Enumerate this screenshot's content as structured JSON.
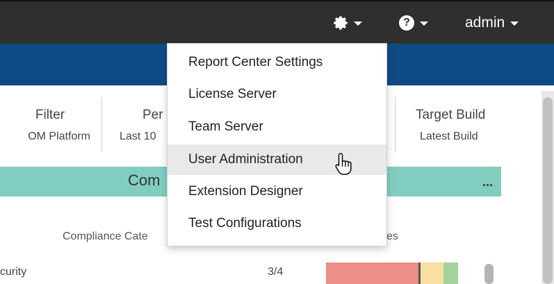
{
  "topbar": {
    "settings_icon": "gear-icon",
    "help_icon": "question-circle-icon",
    "help_glyph": "?",
    "user_label": "admin",
    "colors": {
      "bar": "#2f2f2f",
      "band": "#0e4a85"
    }
  },
  "filters": [
    {
      "label": "Filter",
      "value": "OM Platform"
    },
    {
      "label": "Per",
      "value": "Last 10"
    },
    {
      "label": "Target Build",
      "value": "Latest Build"
    }
  ],
  "widget": {
    "title": "Com",
    "menu_icon": "more-icon",
    "column_category": "Compliance Cate",
    "column_status": "es",
    "rows": [
      {
        "category": "curity",
        "value": "3/4"
      }
    ],
    "colors": {
      "header": "#81cec1",
      "fail": "#ec8f87",
      "warn": "#f9dfa0",
      "pass": "#a4d39c"
    }
  },
  "settings_menu": {
    "items": [
      {
        "label": "Report Center Settings"
      },
      {
        "label": "License Server"
      },
      {
        "label": "Team Server"
      },
      {
        "label": "User Administration"
      },
      {
        "label": "Extension Designer"
      },
      {
        "label": "Test Configurations"
      }
    ],
    "hovered_item": "User Administration"
  }
}
